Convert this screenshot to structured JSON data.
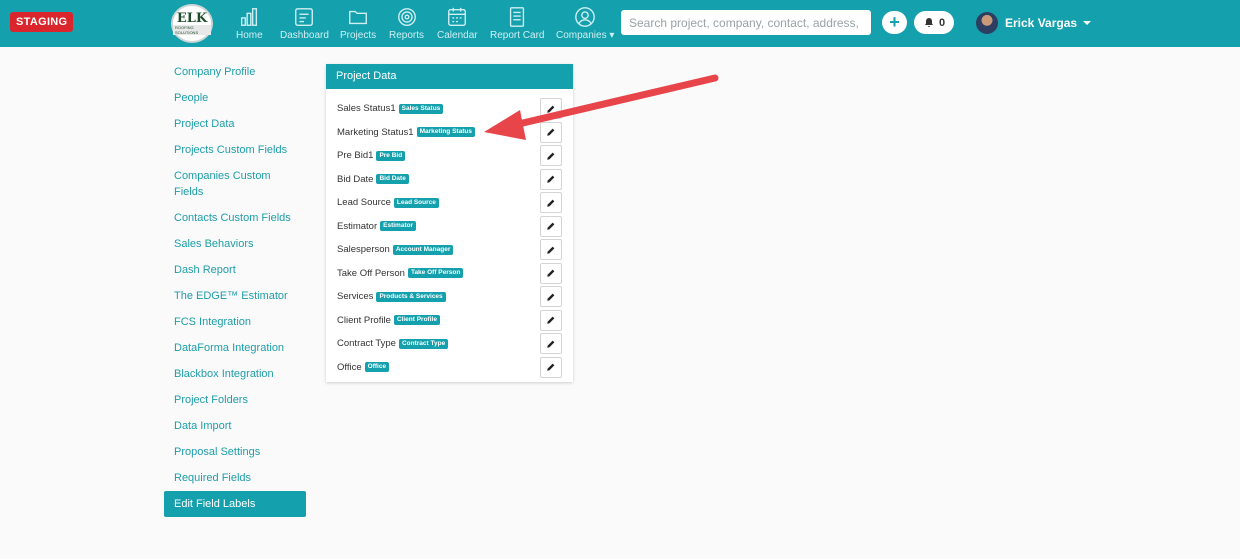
{
  "env_badge": "STAGING",
  "logo": {
    "text": "ELK",
    "subtext": "ROOFING SOLUTIONS"
  },
  "nav": [
    {
      "label": "Home",
      "icon": "bar-chart-icon"
    },
    {
      "label": "Dashboard",
      "icon": "dashboard-icon"
    },
    {
      "label": "Projects",
      "icon": "folder-icon"
    },
    {
      "label": "Reports",
      "icon": "target-icon"
    },
    {
      "label": "Calendar",
      "icon": "calendar-icon"
    },
    {
      "label": "Report Card",
      "icon": "report-card-icon"
    },
    {
      "label": "Companies",
      "icon": "person-icon"
    }
  ],
  "search": {
    "placeholder": "Search project, company, contact, address, phc"
  },
  "notifications": {
    "count": "0"
  },
  "user": {
    "name": "Erick Vargas"
  },
  "sidebar": {
    "items": [
      "Company Profile",
      "People",
      "Project Data",
      "Projects Custom Fields",
      "Companies Custom Fields",
      "Contacts Custom Fields",
      "Sales Behaviors",
      "Dash Report",
      "The EDGE™ Estimator",
      "FCS Integration",
      "DataForma Integration",
      "Blackbox Integration",
      "Project Folders",
      "Data Import",
      "Proposal Settings",
      "Required Fields",
      "Edit Field Labels"
    ],
    "active": "Edit Field Labels"
  },
  "panel": {
    "title": "Project Data",
    "rows": [
      {
        "label": "Sales Status1",
        "badge": "Sales Status"
      },
      {
        "label": "Marketing Status1",
        "badge": "Marketing Status"
      },
      {
        "label": "Pre Bid1",
        "badge": "Pre Bid"
      },
      {
        "label": "Bid Date",
        "badge": "Bid Date"
      },
      {
        "label": "Lead Source",
        "badge": "Lead Source"
      },
      {
        "label": "Estimator",
        "badge": "Estimator"
      },
      {
        "label": "Salesperson",
        "badge": "Account Manager"
      },
      {
        "label": "Take Off Person",
        "badge": "Take Off Person"
      },
      {
        "label": "Services",
        "badge": "Products & Services"
      },
      {
        "label": "Client Profile",
        "badge": "Client Profile"
      },
      {
        "label": "Contract Type",
        "badge": "Contract Type"
      },
      {
        "label": "Office",
        "badge": "Office"
      }
    ]
  },
  "colors": {
    "accent": "#14a0ad",
    "staging": "#d9252b",
    "arrow": "#e8454a"
  }
}
